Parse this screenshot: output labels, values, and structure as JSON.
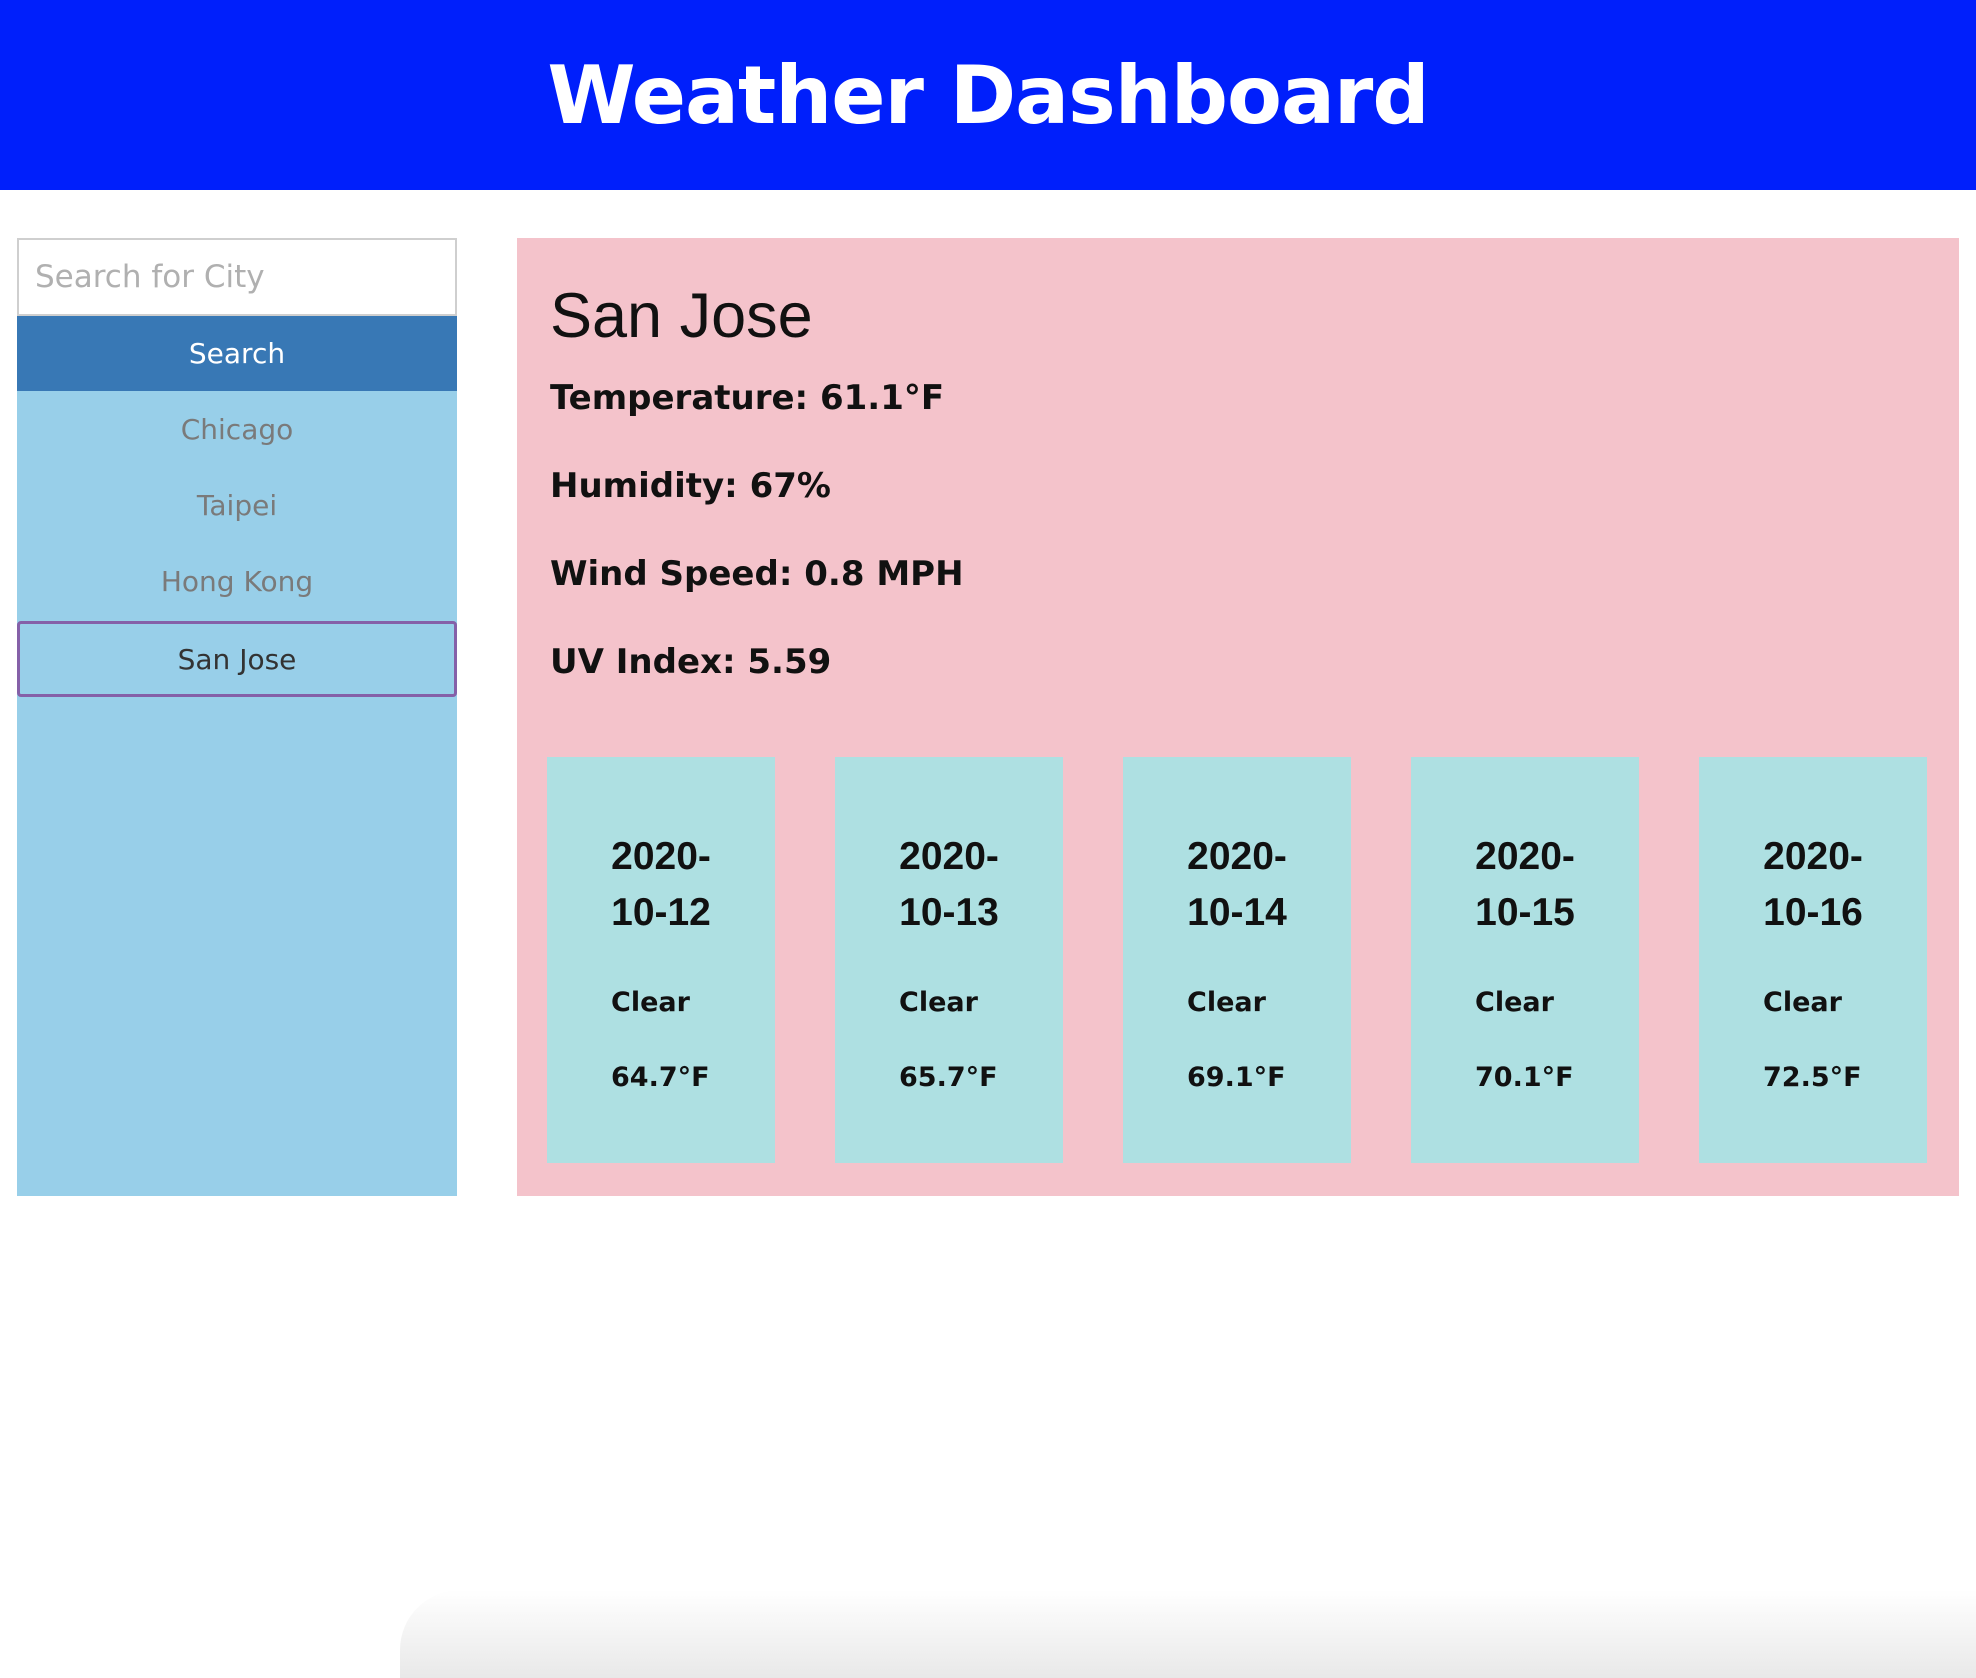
{
  "header": {
    "title": "Weather Dashboard"
  },
  "sidebar": {
    "search_placeholder": "Search for City",
    "search_value": "",
    "search_label": "Search",
    "cities": [
      {
        "label": "Chicago"
      },
      {
        "label": "Taipei"
      },
      {
        "label": "Hong Kong"
      },
      {
        "label": "San Jose"
      }
    ],
    "active_city": "San Jose"
  },
  "current": {
    "city": "San Jose",
    "temperature": "Temperature: 61.1°F",
    "humidity": "Humidity: 67%",
    "wind_speed": "Wind Speed: 0.8 MPH",
    "uv_index": "UV Index: 5.59"
  },
  "forecast": [
    {
      "date_line1": "2020-",
      "date_line2": "10-12",
      "condition": "Clear",
      "temp": "64.7°F"
    },
    {
      "date_line1": "2020-",
      "date_line2": "10-13",
      "condition": "Clear",
      "temp": "65.7°F"
    },
    {
      "date_line1": "2020-",
      "date_line2": "10-14",
      "condition": "Clear",
      "temp": "69.1°F"
    },
    {
      "date_line1": "2020-",
      "date_line2": "10-15",
      "condition": "Clear",
      "temp": "70.1°F"
    },
    {
      "date_line1": "2020-",
      "date_line2": "10-16",
      "condition": "Clear",
      "temp": "72.5°F"
    }
  ],
  "colors": {
    "header_bg": "#001ffb",
    "sidebar_bg": "#98cfe9",
    "search_button_bg": "#3878b5",
    "main_panel_bg": "#f4c3cb",
    "forecast_card_bg": "#aee0e2",
    "active_city_border": "#8560a8"
  }
}
